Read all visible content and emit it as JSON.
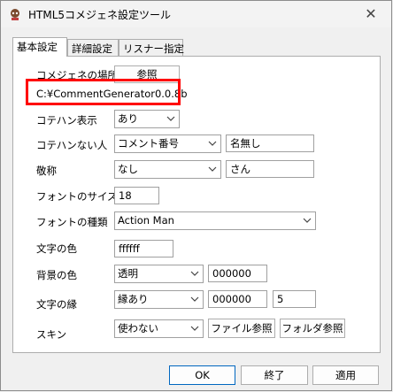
{
  "window": {
    "title": "HTML5コメジェネ設定ツール"
  },
  "tabs": [
    {
      "label": "基本設定",
      "active": true
    },
    {
      "label": "詳細設定",
      "active": false
    },
    {
      "label": "リスナー指定",
      "active": false
    }
  ],
  "location": {
    "label": "コメジェネの場所",
    "browse_label": "参照",
    "path": "C:¥CommentGenerator0.0.8b"
  },
  "kotehan_display": {
    "label": "コテハン表示",
    "value": "あり"
  },
  "no_kotehan": {
    "label": "コテハンない人",
    "value": "コメント番号",
    "name_value": "名無し"
  },
  "honorific": {
    "label": "敬称",
    "value": "なし",
    "text_value": "さん"
  },
  "font_size": {
    "label": "フォントのサイズ",
    "value": "18"
  },
  "font_type": {
    "label": "フォントの種類",
    "value": "Action Man"
  },
  "text_color": {
    "label": "文字の色",
    "value": "ffffff"
  },
  "bg_color": {
    "label": "背景の色",
    "value": "透明",
    "color_value": "000000"
  },
  "text_edge": {
    "label": "文字の縁",
    "value": "縁あり",
    "color_value": "000000",
    "width_value": "5"
  },
  "skin": {
    "label": "スキン",
    "value": "使わない",
    "file_button": "ファイル参照",
    "folder_button": "フォルダ参照"
  },
  "footer": {
    "ok": "OK",
    "exit": "終了",
    "apply": "適用"
  },
  "colors": {
    "highlight": "#ff0000",
    "default_button_border": "#0067c0"
  }
}
